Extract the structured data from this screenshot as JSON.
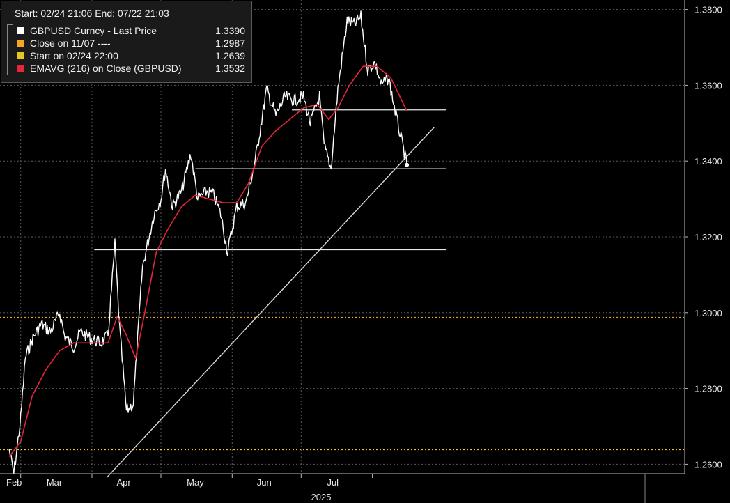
{
  "legend": {
    "header": "Start: 02/24 21:06 End: 07/22 21:03",
    "items": [
      {
        "label": "GBPUSD Curncy - Last Price",
        "value": "1.3390",
        "color": "#ffffff"
      },
      {
        "label": "Close on 11/07 ----",
        "value": "1.2987",
        "color": "#f5a623"
      },
      {
        "label": "Start on 02/24 22:00",
        "value": "1.2639",
        "color": "#e8c520"
      },
      {
        "label": "EMAVG (216)  on Close (GBPUSD)",
        "value": "1.3532",
        "color": "#e8253a"
      }
    ]
  },
  "chart_data": {
    "type": "line",
    "x_axis": {
      "months": [
        "Feb",
        "Mar",
        "Apr",
        "May",
        "Jun",
        "Jul"
      ],
      "year_label": "2025"
    },
    "y_axis": {
      "ticks": [
        "1.2600",
        "1.2800",
        "1.3000",
        "1.3200",
        "1.3400",
        "1.3600",
        "1.3800"
      ],
      "range": [
        1.2575,
        1.3825
      ]
    },
    "series": [
      {
        "name": "GBPUSD Curncy - Last Price",
        "color": "#ffffff",
        "points": [
          [
            "02-24",
            1.2639
          ],
          [
            "02-26",
            1.2575
          ],
          [
            "03-01",
            1.272
          ],
          [
            "03-03",
            1.288
          ],
          [
            "03-06",
            1.293
          ],
          [
            "03-10",
            1.297
          ],
          [
            "03-14",
            1.295
          ],
          [
            "03-18",
            1.3
          ],
          [
            "03-20",
            1.294
          ],
          [
            "03-24",
            1.291
          ],
          [
            "03-27",
            1.295
          ],
          [
            "04-01",
            1.293
          ],
          [
            "04-05",
            1.292
          ],
          [
            "04-08",
            1.294
          ],
          [
            "04-11",
            1.318
          ],
          [
            "04-13",
            1.296
          ],
          [
            "04-16",
            1.274
          ],
          [
            "04-19",
            1.276
          ],
          [
            "04-23",
            1.312
          ],
          [
            "04-28",
            1.326
          ],
          [
            "05-01",
            1.33
          ],
          [
            "05-03",
            1.338
          ],
          [
            "05-06",
            1.328
          ],
          [
            "05-10",
            1.332
          ],
          [
            "05-14",
            1.342
          ],
          [
            "05-17",
            1.33
          ],
          [
            "05-21",
            1.332
          ],
          [
            "05-24",
            1.331
          ],
          [
            "05-27",
            1.326
          ],
          [
            "05-30",
            1.316
          ],
          [
            "06-03",
            1.328
          ],
          [
            "06-07",
            1.329
          ],
          [
            "06-11",
            1.34
          ],
          [
            "06-16",
            1.359
          ],
          [
            "06-20",
            1.352
          ],
          [
            "06-24",
            1.357
          ],
          [
            "06-28",
            1.356
          ],
          [
            "07-02",
            1.357
          ],
          [
            "07-05",
            1.35
          ],
          [
            "07-09",
            1.357
          ],
          [
            "07-11",
            1.344
          ],
          [
            "07-14",
            1.338
          ],
          [
            "07-17",
            1.359
          ],
          [
            "07-21",
            1.377
          ],
          [
            "07-24",
            1.376
          ],
          [
            "07-27",
            1.378
          ],
          [
            "07-30",
            1.364
          ],
          [
            "08-02",
            1.366
          ],
          [
            "08-05",
            1.36
          ],
          [
            "08-08",
            1.362
          ],
          [
            "08-12",
            1.35
          ],
          [
            "08-16",
            1.339
          ]
        ]
      },
      {
        "name": "EMAVG (216)  on Close (GBPUSD)",
        "color": "#e8253a",
        "points": [
          [
            "02-24",
            1.262
          ],
          [
            "03-01",
            1.266
          ],
          [
            "03-06",
            1.278
          ],
          [
            "03-12",
            1.285
          ],
          [
            "03-18",
            1.29
          ],
          [
            "03-24",
            1.292
          ],
          [
            "04-01",
            1.292
          ],
          [
            "04-08",
            1.292
          ],
          [
            "04-12",
            1.299
          ],
          [
            "04-16",
            1.294
          ],
          [
            "04-20",
            1.288
          ],
          [
            "04-24",
            1.3
          ],
          [
            "04-29",
            1.316
          ],
          [
            "05-04",
            1.322
          ],
          [
            "05-10",
            1.328
          ],
          [
            "05-16",
            1.331
          ],
          [
            "05-22",
            1.33
          ],
          [
            "05-28",
            1.329
          ],
          [
            "06-03",
            1.329
          ],
          [
            "06-08",
            1.334
          ],
          [
            "06-14",
            1.344
          ],
          [
            "06-20",
            1.348
          ],
          [
            "06-26",
            1.351
          ],
          [
            "07-02",
            1.354
          ],
          [
            "07-08",
            1.355
          ],
          [
            "07-13",
            1.351
          ],
          [
            "07-17",
            1.354
          ],
          [
            "07-22",
            1.36
          ],
          [
            "07-28",
            1.365
          ],
          [
            "08-03",
            1.365
          ],
          [
            "08-09",
            1.362
          ],
          [
            "08-16",
            1.3532
          ]
        ]
      }
    ],
    "reference_lines": [
      {
        "name": "Close on 11/07 ----",
        "y": 1.2987,
        "color": "#f5a623",
        "style": "dotted"
      },
      {
        "name": "Start on 02/24 22:00",
        "y": 1.2639,
        "color": "#e8c520",
        "style": "dotted"
      }
    ],
    "support_resistance_lines": [
      {
        "y": 1.3166,
        "x_start": "04-02"
      },
      {
        "y": 1.338,
        "x_start": "05-16"
      },
      {
        "y": 1.3535,
        "x_start": "06-27"
      }
    ],
    "trendline": [
      [
        "02-24",
        1.2565
      ],
      [
        "08-28",
        1.349
      ]
    ],
    "last_price_marker": 1.339,
    "grid": true
  }
}
